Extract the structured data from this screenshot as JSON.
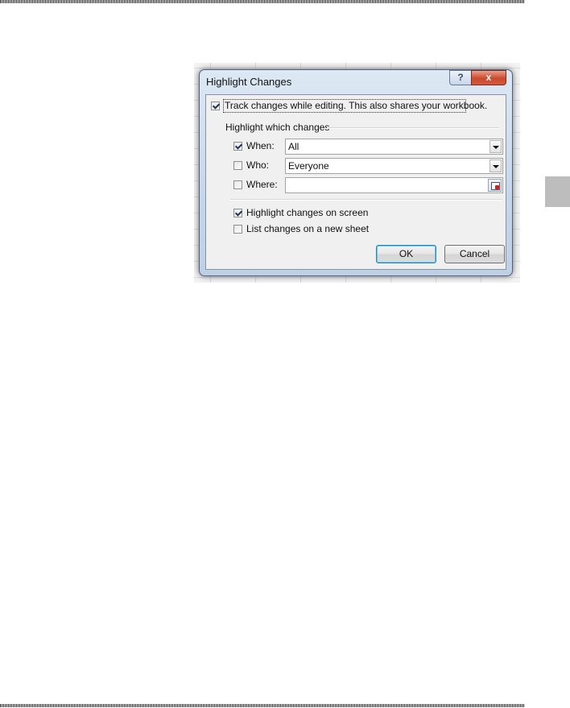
{
  "dialog": {
    "title": "Highlight Changes",
    "help_label": "?",
    "close_label": "x",
    "track_changes": {
      "label": "Track changes while editing. This also shares your workbook.",
      "checked": true
    },
    "group_label": "Highlight which changes",
    "when": {
      "label": "When:",
      "checked": true,
      "value": "All"
    },
    "who": {
      "label": "Who:",
      "checked": false,
      "value": "Everyone"
    },
    "where": {
      "label": "Where:",
      "checked": false,
      "value": ""
    },
    "highlight_on_screen": {
      "label": "Highlight changes on screen",
      "checked": true
    },
    "list_on_new_sheet": {
      "label": "List changes on a new sheet",
      "checked": false
    },
    "ok_label": "OK",
    "cancel_label": "Cancel"
  }
}
